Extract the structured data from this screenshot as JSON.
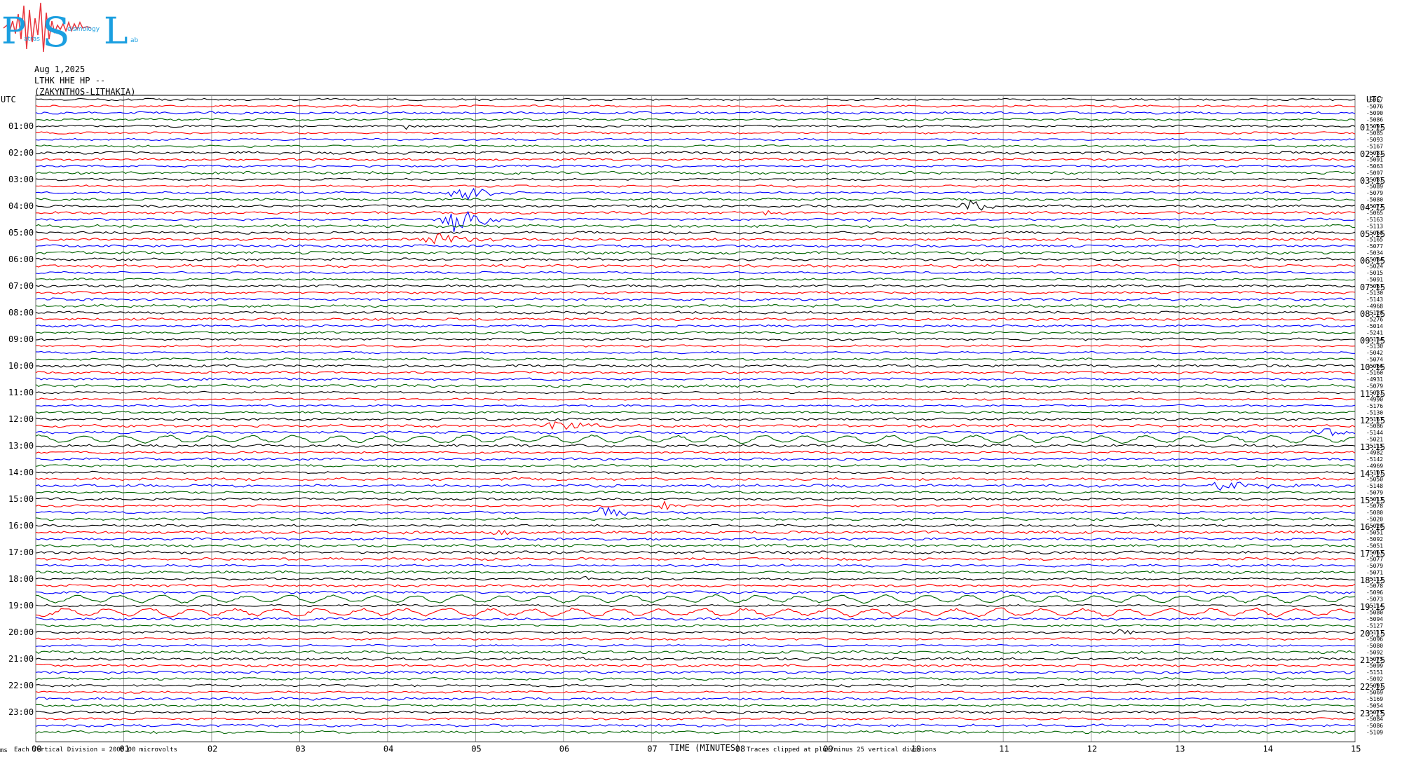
{
  "logo": {
    "letters": [
      "P",
      "S",
      "L"
    ],
    "words": [
      "atras",
      "eismology",
      "ab"
    ],
    "colors": {
      "primary": "#1b9fe0",
      "trace": "#e8343c"
    }
  },
  "header": {
    "date": "Aug 1,2025",
    "station": "LTHK HHE HP --",
    "location": "(ZAKYNTHOS-LITHAKIA)"
  },
  "chart_data": {
    "type": "line",
    "title": "",
    "left_axis_title": "UTC",
    "right_axis_title": "UTC",
    "left_labels": [
      "01:00",
      "02:00",
      "03:00",
      "04:00",
      "05:00",
      "06:00",
      "07:00",
      "08:00",
      "09:00",
      "10:00",
      "11:00",
      "12:00",
      "13:00",
      "14:00",
      "15:00",
      "16:00",
      "17:00",
      "18:00",
      "19:00",
      "20:00",
      "21:00",
      "22:00",
      "23:00"
    ],
    "right_labels": [
      "01:15",
      "02:15",
      "03:15",
      "04:15",
      "05:15",
      "06:15",
      "07:15",
      "08:15",
      "09:15",
      "10:15",
      "11:15",
      "12:15",
      "13:15",
      "14:15",
      "15:15",
      "16:15",
      "17:15",
      "18:15",
      "19:15",
      "20:15",
      "21:15",
      "22:15",
      "23:15"
    ],
    "x_ticks": [
      "00",
      "01",
      "02",
      "03",
      "04",
      "05",
      "06",
      "07",
      "08",
      "09",
      "10",
      "11",
      "12",
      "13",
      "14",
      "15"
    ],
    "xlim": [
      0,
      15
    ],
    "xlabel": "TIME (MINUTES)",
    "trace_count": 96,
    "trace_colors": [
      "#000000",
      "#ff0000",
      "#0000ff",
      "#006400"
    ],
    "right_offsets": [
      "-5057",
      "-5076",
      "-5090",
      "-5086",
      "-5091",
      "-5085",
      "-5093",
      "-5167",
      "-5081",
      "-5091",
      "-5063",
      "-5097",
      "-5081",
      "-5089",
      "-5079",
      "-5080",
      "-5072",
      "-5065",
      "-5163",
      "-5113",
      "-5060",
      "-5165",
      "-5077",
      "-5034",
      "-5084",
      "-5024",
      "-5015",
      "-5091",
      "-5067",
      "-5130",
      "-5143",
      "-4968",
      "-5120",
      "-5276",
      "-5014",
      "-5241",
      "-5134",
      "-5130",
      "-5042",
      "-5074",
      "-5066",
      "-5160",
      "-4931",
      "-5079",
      "-5031",
      "-4990",
      "-5176",
      "-5130",
      "-5167",
      "-5086",
      "-5144",
      "-5021",
      "-5115",
      "-4982",
      "-5142",
      "-4969",
      "-5101",
      "-5050",
      "-5148",
      "-5079",
      "-5013",
      "-5078",
      "-5080",
      "-5020",
      "-5020",
      "-5051",
      "-5092",
      "-5051",
      "-5063",
      "-5077",
      "-5079",
      "-5071",
      "-5112",
      "-5078",
      "-5096",
      "-5073",
      "-5114",
      "-5080",
      "-5094",
      "-5127",
      "-5111",
      "-5096",
      "-5080",
      "-5092",
      "-5075",
      "-5099",
      "-5151",
      "-5092",
      "-5091",
      "-5069",
      "-5169",
      "-5054",
      "-5075",
      "-5084",
      "-5086",
      "-5109"
    ],
    "events": [
      {
        "trace": 4,
        "minute": 4.2,
        "amp": 6,
        "dur": 0.2
      },
      {
        "trace": 18,
        "minute": 9.4,
        "amp": 5,
        "dur": 0.3
      },
      {
        "trace": 16,
        "minute": 10.6,
        "amp": 14,
        "dur": 0.4
      },
      {
        "trace": 14,
        "minute": 4.8,
        "amp": 18,
        "dur": 0.5
      },
      {
        "trace": 18,
        "minute": 4.7,
        "amp": 26,
        "dur": 0.6
      },
      {
        "trace": 21,
        "minute": 4.5,
        "amp": 10,
        "dur": 0.8
      },
      {
        "trace": 17,
        "minute": 8.3,
        "amp": 7,
        "dur": 0.3
      },
      {
        "trace": 30,
        "minute": 8.0,
        "amp": 6,
        "dur": 0.3
      },
      {
        "trace": 49,
        "minute": 5.9,
        "amp": 14,
        "dur": 0.5
      },
      {
        "trace": 50,
        "minute": 14.6,
        "amp": 12,
        "dur": 0.5
      },
      {
        "trace": 58,
        "minute": 13.4,
        "amp": 9,
        "dur": 0.8
      },
      {
        "trace": 62,
        "minute": 6.4,
        "amp": 10,
        "dur": 0.6
      },
      {
        "trace": 61,
        "minute": 7.1,
        "amp": 9,
        "dur": 0.3
      },
      {
        "trace": 72,
        "minute": 6.2,
        "amp": 8,
        "dur": 0.3
      },
      {
        "trace": 80,
        "minute": 12.3,
        "amp": 5,
        "dur": 0.4
      },
      {
        "trace": 65,
        "minute": 5.2,
        "amp": 6,
        "dur": 0.4
      }
    ],
    "swell_traces": [
      51,
      75,
      77
    ],
    "footer_left": "Each Vertical Division = 2000.00 microvolts",
    "footer_right": "Traces clipped at plus/minus 25 vertical divisions",
    "footer_mark": "ms"
  }
}
